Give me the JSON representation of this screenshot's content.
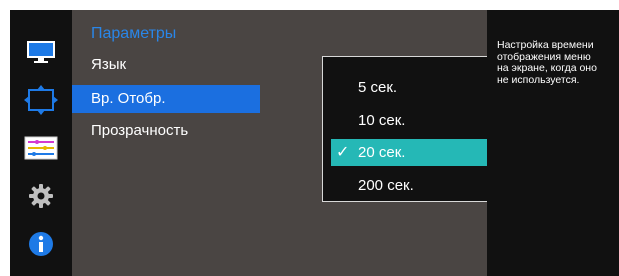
{
  "sidebar": {
    "icons": [
      "monitor-icon",
      "resize-icon",
      "sliders-icon",
      "gear-icon",
      "info-icon"
    ]
  },
  "menu": {
    "title": "Параметры",
    "items": [
      {
        "label": "Язык"
      },
      {
        "label": "Вр. Отобр.",
        "active": true
      },
      {
        "label": "Прозрачность"
      }
    ]
  },
  "dropdown": {
    "options": [
      "5 сек.",
      "10 сек.",
      "20 сек.",
      "200 сек."
    ],
    "selected": "20 сек.",
    "check_glyph": "✓"
  },
  "help": {
    "text": "Настройка времени\nотображения меню\nна экране, когда оно\nне используется."
  },
  "colors": {
    "accent_blue": "#1b6fe0",
    "title_blue": "#2a86e8",
    "selected_teal": "#25b8b6"
  }
}
